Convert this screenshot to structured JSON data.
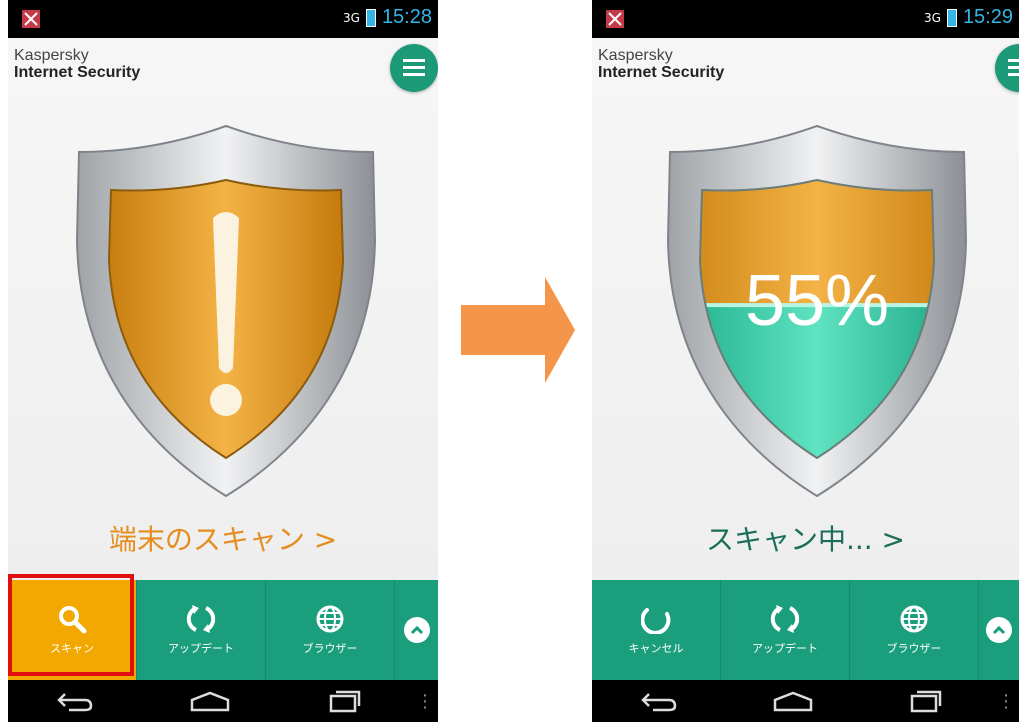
{
  "left": {
    "status": {
      "time": "15:28",
      "signal": "3G"
    },
    "brand": {
      "line1": "Kaspersky",
      "line2": "Internet Security"
    },
    "scan_link": "端末のスキャン >",
    "toolbar": {
      "scan_label": "スキャン",
      "update_label": "アップデート",
      "browser_label": "ブラウザー"
    }
  },
  "right": {
    "status": {
      "time": "15:29",
      "signal": "3G"
    },
    "brand": {
      "line1": "Kaspersky",
      "line2": "Internet Security"
    },
    "progress_label": "55%",
    "progress": 0.55,
    "scan_link": "スキャン中... >",
    "toolbar": {
      "cancel_label": "キャンセル",
      "update_label": "アップデート",
      "browser_label": "ブラウザー"
    }
  },
  "colors": {
    "accent_green": "#1a9e7b",
    "warning_orange": "#f2a800",
    "highlight_red": "#e10e0e",
    "status_blue": "#35b5e5",
    "arrow_orange": "#f5954a"
  },
  "icons": {
    "left_scan": "search-icon",
    "update": "refresh-icon",
    "browser": "globe-icon",
    "more": "chevron-up-icon",
    "cancel": "spinner-icon"
  }
}
